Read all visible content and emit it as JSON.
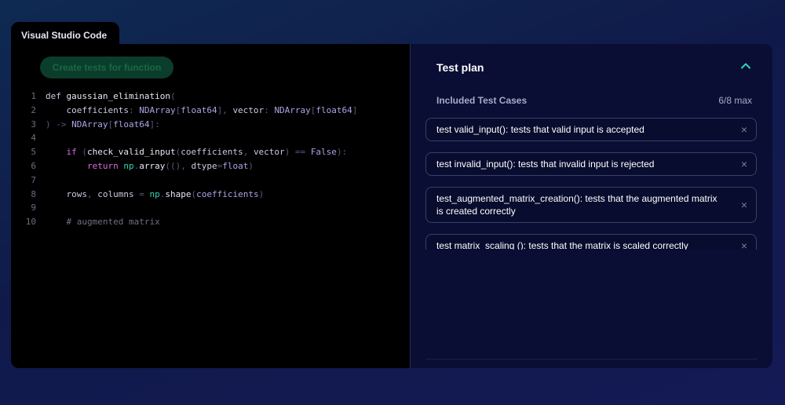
{
  "window_tab": {
    "label": "Visual Studio Code"
  },
  "editor": {
    "create_button_label": "Create tests for function",
    "lines": [
      {
        "num": "1",
        "tokens": [
          {
            "t": "def ",
            "c": "kw"
          },
          {
            "t": "gaussian_elimination",
            "c": "fn"
          },
          {
            "t": "(",
            "c": "pn"
          }
        ]
      },
      {
        "num": "2",
        "tokens": [
          {
            "t": "    coefficients",
            "c": "tx"
          },
          {
            "t": ": ",
            "c": "pn"
          },
          {
            "t": "NDArray",
            "c": "ty"
          },
          {
            "t": "[",
            "c": "pn"
          },
          {
            "t": "float64",
            "c": "ty"
          },
          {
            "t": "], ",
            "c": "pn"
          },
          {
            "t": "vector",
            "c": "tx"
          },
          {
            "t": ": ",
            "c": "pn"
          },
          {
            "t": "NDArray",
            "c": "ty"
          },
          {
            "t": "[",
            "c": "pn"
          },
          {
            "t": "float64",
            "c": "ty"
          },
          {
            "t": "]",
            "c": "pn"
          }
        ]
      },
      {
        "num": "3",
        "tokens": [
          {
            "t": ") -> ",
            "c": "pn"
          },
          {
            "t": "NDArray",
            "c": "ty"
          },
          {
            "t": "[",
            "c": "pn"
          },
          {
            "t": "float64",
            "c": "ty"
          },
          {
            "t": "]:",
            "c": "pn"
          }
        ]
      },
      {
        "num": "4",
        "tokens": []
      },
      {
        "num": "5",
        "tokens": [
          {
            "t": "    if ",
            "c": "ctl"
          },
          {
            "t": "(",
            "c": "pn"
          },
          {
            "t": "check_valid_input",
            "c": "fn"
          },
          {
            "t": "(",
            "c": "pn"
          },
          {
            "t": "coefficients",
            "c": "tx"
          },
          {
            "t": ", ",
            "c": "pn"
          },
          {
            "t": "vector",
            "c": "tx"
          },
          {
            "t": ") == ",
            "c": "pn"
          },
          {
            "t": "False",
            "c": "ty"
          },
          {
            "t": "):",
            "c": "pn"
          }
        ]
      },
      {
        "num": "6",
        "tokens": [
          {
            "t": "        return ",
            "c": "ctl"
          },
          {
            "t": "np",
            "c": "np"
          },
          {
            "t": ".",
            "c": "pn"
          },
          {
            "t": "array",
            "c": "fn"
          },
          {
            "t": "((), ",
            "c": "pn"
          },
          {
            "t": "dtype",
            "c": "tx"
          },
          {
            "t": "=",
            "c": "pn"
          },
          {
            "t": "float",
            "c": "ty"
          },
          {
            "t": ")",
            "c": "pn"
          }
        ]
      },
      {
        "num": "7",
        "tokens": []
      },
      {
        "num": "8",
        "tokens": [
          {
            "t": "    rows",
            "c": "tx"
          },
          {
            "t": ", ",
            "c": "pn"
          },
          {
            "t": "columns",
            "c": "tx"
          },
          {
            "t": " = ",
            "c": "pn"
          },
          {
            "t": "np",
            "c": "np"
          },
          {
            "t": ".",
            "c": "pn"
          },
          {
            "t": "shape",
            "c": "fn"
          },
          {
            "t": "(",
            "c": "pn"
          },
          {
            "t": "coefficients",
            "c": "ty"
          },
          {
            "t": ")",
            "c": "pn"
          }
        ]
      },
      {
        "num": "9",
        "tokens": []
      },
      {
        "num": "10",
        "tokens": [
          {
            "t": "    # augmented matrix",
            "c": "cm"
          }
        ]
      }
    ]
  },
  "test_plan": {
    "title": "Test plan",
    "section_label": "Included Test Cases",
    "count": "6/8 max",
    "cases": [
      "test valid_input(): tests that valid input is accepted",
      "test invalid_input(): tests that invalid input is rejected",
      "test_augmented_matrix_creation(): tests that the augmented matrix is created correctly",
      "test matrix_scaling (): tests that the matrix is scaled correctly"
    ],
    "icons": {
      "collapse": "chevron-up-icon",
      "remove": "close-icon"
    },
    "accent_color": "#2fd6b0"
  }
}
